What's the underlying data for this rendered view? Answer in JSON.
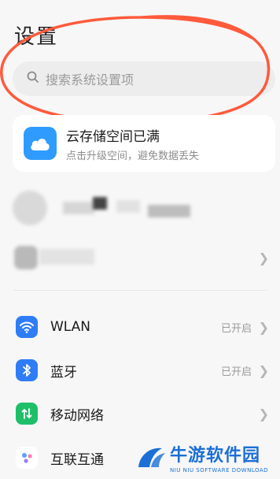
{
  "page": {
    "title": "设置"
  },
  "search": {
    "placeholder": "搜索系统设置项"
  },
  "cloud_card": {
    "title": "云存储空间已满",
    "subtitle": "点击升级空间，避免数据丢失",
    "icon": "cloud-icon",
    "color": "#2f9bff"
  },
  "account_row": {
    "label_partial": "账号"
  },
  "settings": [
    {
      "label": "WLAN",
      "status": "已开启",
      "icon": "wifi-icon",
      "color": "#2f7df6"
    },
    {
      "label": "蓝牙",
      "status": "已开启",
      "icon": "bluetooth-icon",
      "color": "#2f7df6"
    },
    {
      "label": "移动网络",
      "status": "",
      "icon": "mobile-network-icon",
      "color": "#1fbf6a"
    },
    {
      "label": "互联互通",
      "status": "",
      "icon": "connect-icon",
      "color": "#ffffff"
    }
  ],
  "watermark": {
    "title": "牛游软件园",
    "subtitle": "NIU NIU SOFTWARE DOWNLOAD"
  }
}
